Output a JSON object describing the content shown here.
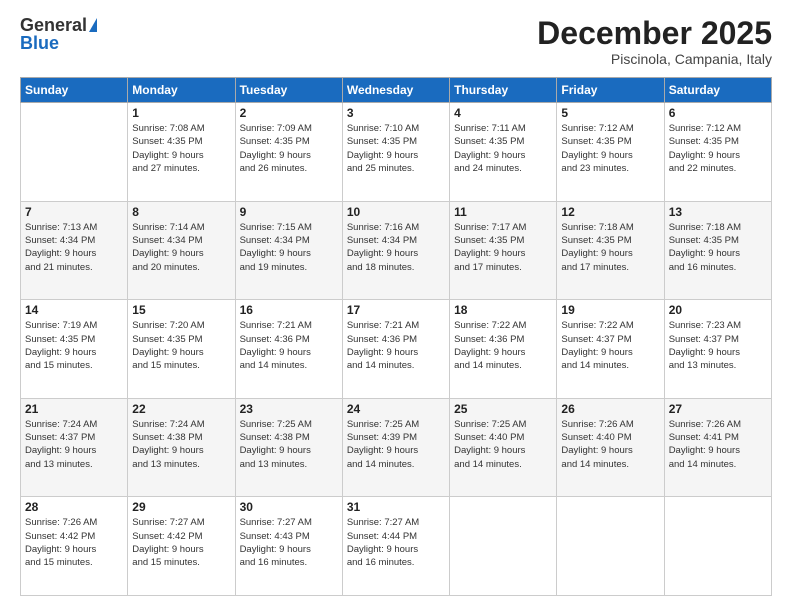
{
  "logo": {
    "general": "General",
    "blue": "Blue"
  },
  "header": {
    "month": "December 2025",
    "location": "Piscinola, Campania, Italy"
  },
  "weekdays": [
    "Sunday",
    "Monday",
    "Tuesday",
    "Wednesday",
    "Thursday",
    "Friday",
    "Saturday"
  ],
  "weeks": [
    [
      {
        "day": "",
        "info": ""
      },
      {
        "day": "1",
        "info": "Sunrise: 7:08 AM\nSunset: 4:35 PM\nDaylight: 9 hours\nand 27 minutes."
      },
      {
        "day": "2",
        "info": "Sunrise: 7:09 AM\nSunset: 4:35 PM\nDaylight: 9 hours\nand 26 minutes."
      },
      {
        "day": "3",
        "info": "Sunrise: 7:10 AM\nSunset: 4:35 PM\nDaylight: 9 hours\nand 25 minutes."
      },
      {
        "day": "4",
        "info": "Sunrise: 7:11 AM\nSunset: 4:35 PM\nDaylight: 9 hours\nand 24 minutes."
      },
      {
        "day": "5",
        "info": "Sunrise: 7:12 AM\nSunset: 4:35 PM\nDaylight: 9 hours\nand 23 minutes."
      },
      {
        "day": "6",
        "info": "Sunrise: 7:12 AM\nSunset: 4:35 PM\nDaylight: 9 hours\nand 22 minutes."
      }
    ],
    [
      {
        "day": "7",
        "info": "Sunrise: 7:13 AM\nSunset: 4:34 PM\nDaylight: 9 hours\nand 21 minutes."
      },
      {
        "day": "8",
        "info": "Sunrise: 7:14 AM\nSunset: 4:34 PM\nDaylight: 9 hours\nand 20 minutes."
      },
      {
        "day": "9",
        "info": "Sunrise: 7:15 AM\nSunset: 4:34 PM\nDaylight: 9 hours\nand 19 minutes."
      },
      {
        "day": "10",
        "info": "Sunrise: 7:16 AM\nSunset: 4:34 PM\nDaylight: 9 hours\nand 18 minutes."
      },
      {
        "day": "11",
        "info": "Sunrise: 7:17 AM\nSunset: 4:35 PM\nDaylight: 9 hours\nand 17 minutes."
      },
      {
        "day": "12",
        "info": "Sunrise: 7:18 AM\nSunset: 4:35 PM\nDaylight: 9 hours\nand 17 minutes."
      },
      {
        "day": "13",
        "info": "Sunrise: 7:18 AM\nSunset: 4:35 PM\nDaylight: 9 hours\nand 16 minutes."
      }
    ],
    [
      {
        "day": "14",
        "info": "Sunrise: 7:19 AM\nSunset: 4:35 PM\nDaylight: 9 hours\nand 15 minutes."
      },
      {
        "day": "15",
        "info": "Sunrise: 7:20 AM\nSunset: 4:35 PM\nDaylight: 9 hours\nand 15 minutes."
      },
      {
        "day": "16",
        "info": "Sunrise: 7:21 AM\nSunset: 4:36 PM\nDaylight: 9 hours\nand 14 minutes."
      },
      {
        "day": "17",
        "info": "Sunrise: 7:21 AM\nSunset: 4:36 PM\nDaylight: 9 hours\nand 14 minutes."
      },
      {
        "day": "18",
        "info": "Sunrise: 7:22 AM\nSunset: 4:36 PM\nDaylight: 9 hours\nand 14 minutes."
      },
      {
        "day": "19",
        "info": "Sunrise: 7:22 AM\nSunset: 4:37 PM\nDaylight: 9 hours\nand 14 minutes."
      },
      {
        "day": "20",
        "info": "Sunrise: 7:23 AM\nSunset: 4:37 PM\nDaylight: 9 hours\nand 13 minutes."
      }
    ],
    [
      {
        "day": "21",
        "info": "Sunrise: 7:24 AM\nSunset: 4:37 PM\nDaylight: 9 hours\nand 13 minutes."
      },
      {
        "day": "22",
        "info": "Sunrise: 7:24 AM\nSunset: 4:38 PM\nDaylight: 9 hours\nand 13 minutes."
      },
      {
        "day": "23",
        "info": "Sunrise: 7:25 AM\nSunset: 4:38 PM\nDaylight: 9 hours\nand 13 minutes."
      },
      {
        "day": "24",
        "info": "Sunrise: 7:25 AM\nSunset: 4:39 PM\nDaylight: 9 hours\nand 14 minutes."
      },
      {
        "day": "25",
        "info": "Sunrise: 7:25 AM\nSunset: 4:40 PM\nDaylight: 9 hours\nand 14 minutes."
      },
      {
        "day": "26",
        "info": "Sunrise: 7:26 AM\nSunset: 4:40 PM\nDaylight: 9 hours\nand 14 minutes."
      },
      {
        "day": "27",
        "info": "Sunrise: 7:26 AM\nSunset: 4:41 PM\nDaylight: 9 hours\nand 14 minutes."
      }
    ],
    [
      {
        "day": "28",
        "info": "Sunrise: 7:26 AM\nSunset: 4:42 PM\nDaylight: 9 hours\nand 15 minutes."
      },
      {
        "day": "29",
        "info": "Sunrise: 7:27 AM\nSunset: 4:42 PM\nDaylight: 9 hours\nand 15 minutes."
      },
      {
        "day": "30",
        "info": "Sunrise: 7:27 AM\nSunset: 4:43 PM\nDaylight: 9 hours\nand 16 minutes."
      },
      {
        "day": "31",
        "info": "Sunrise: 7:27 AM\nSunset: 4:44 PM\nDaylight: 9 hours\nand 16 minutes."
      },
      {
        "day": "",
        "info": ""
      },
      {
        "day": "",
        "info": ""
      },
      {
        "day": "",
        "info": ""
      }
    ]
  ]
}
